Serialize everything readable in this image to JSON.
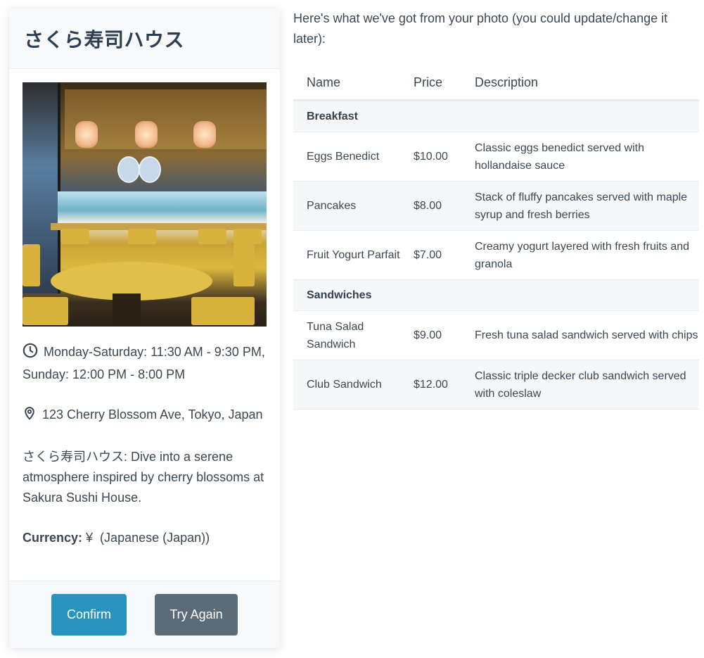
{
  "restaurant": {
    "name": "さくら寿司ハウス",
    "photo_alt": "Restaurant interior photo",
    "hours_icon": "clock-icon",
    "hours": "Monday-Saturday: 11:30 AM - 9:30 PM, Sunday: 12:00 PM - 8:00 PM",
    "address_icon": "map-pin-icon",
    "address": "123 Cherry Blossom Ave, Tokyo, Japan",
    "description": "さくら寿司ハウス: Dive into a serene atmosphere inspired by cherry blossoms at Sakura Sushi House.",
    "currency_label": "Currency:",
    "currency_value": "¥  (Japanese (Japan))"
  },
  "actions": {
    "confirm_label": "Confirm",
    "retry_label": "Try Again"
  },
  "menu": {
    "intro": "Here's what we've got from your photo (you could update/change it later):",
    "columns": [
      "Name",
      "Price",
      "Description"
    ],
    "categories": [
      {
        "name": "Breakfast",
        "items": [
          {
            "name": "Eggs Benedict",
            "price": "$10.00",
            "description": "Classic eggs benedict served with hollandaise sauce"
          },
          {
            "name": "Pancakes",
            "price": "$8.00",
            "description": "Stack of fluffy pancakes served with maple syrup and fresh berries"
          },
          {
            "name": "Fruit Yogurt Parfait",
            "price": "$7.00",
            "description": "Creamy yogurt layered with fresh fruits and granola"
          }
        ]
      },
      {
        "name": "Sandwiches",
        "items": [
          {
            "name": "Tuna Salad Sandwich",
            "price": "$9.00",
            "description": "Fresh tuna salad sandwich served with chips"
          },
          {
            "name": "Club Sandwich",
            "price": "$12.00",
            "description": "Classic triple decker club sandwich served with coleslaw"
          }
        ]
      }
    ]
  },
  "colors": {
    "confirm": "#2a94c0",
    "retry": "#5b6b78",
    "text": "#3b4752",
    "title": "#2c3e50"
  }
}
